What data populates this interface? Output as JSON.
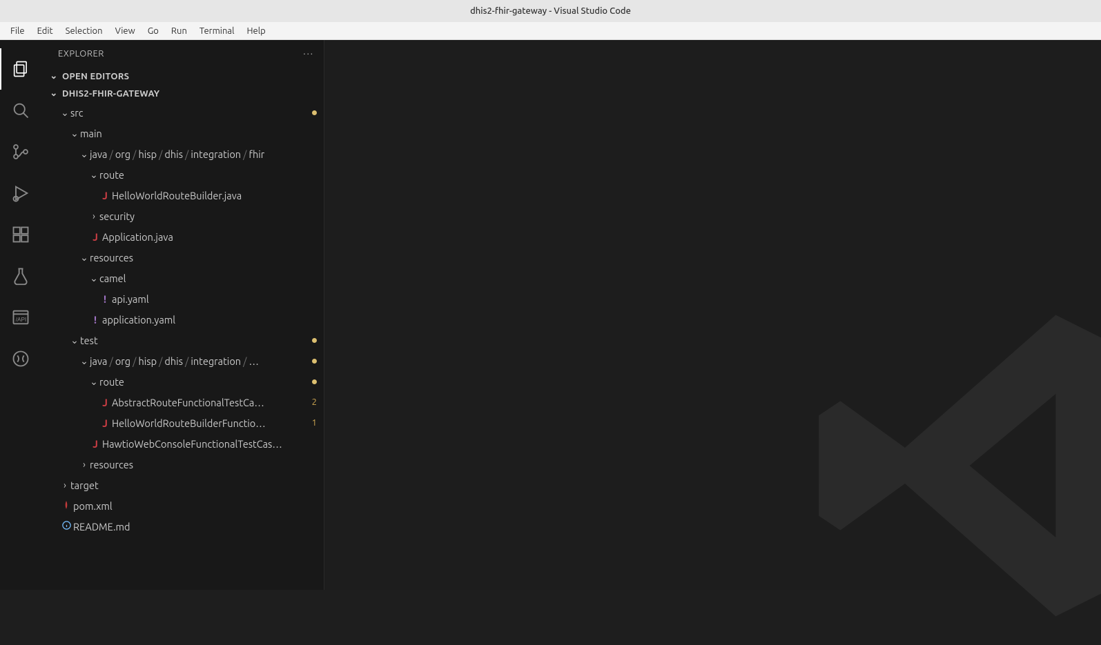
{
  "window": {
    "title": "dhis2-fhir-gateway - Visual Studio Code"
  },
  "menubar": [
    "File",
    "Edit",
    "Selection",
    "View",
    "Go",
    "Run",
    "Terminal",
    "Help"
  ],
  "sidebar": {
    "title": "EXPLORER",
    "sections": {
      "openEditors": "OPEN EDITORS",
      "project": "DHIS2-FHIR-GATEWAY"
    }
  },
  "tree": {
    "src": "src",
    "main": "main",
    "pkg_main": [
      "java",
      "org",
      "hisp",
      "dhis",
      "integration",
      "fhir"
    ],
    "route": "route",
    "helloRoute": "HelloWorldRouteBuilder.java",
    "security": "security",
    "application": "Application.java",
    "resources": "resources",
    "camel": "camel",
    "apiYaml": "api.yaml",
    "applicationYaml": "application.yaml",
    "test": "test",
    "pkg_test": [
      "java",
      "org",
      "hisp",
      "dhis",
      "integration",
      "…"
    ],
    "routeTest": "route",
    "abstractTest": "AbstractRouteFunctionalTestCa…",
    "helloTest": "HelloWorldRouteBuilderFunctio…",
    "hawtio": "HawtioWebConsoleFunctionalTestCas…",
    "resourcesTest": "resources",
    "target": "target",
    "pom": "pom.xml",
    "readme": "README.md"
  },
  "decorations": {
    "abstractTest": "2",
    "helloTest": "1"
  }
}
